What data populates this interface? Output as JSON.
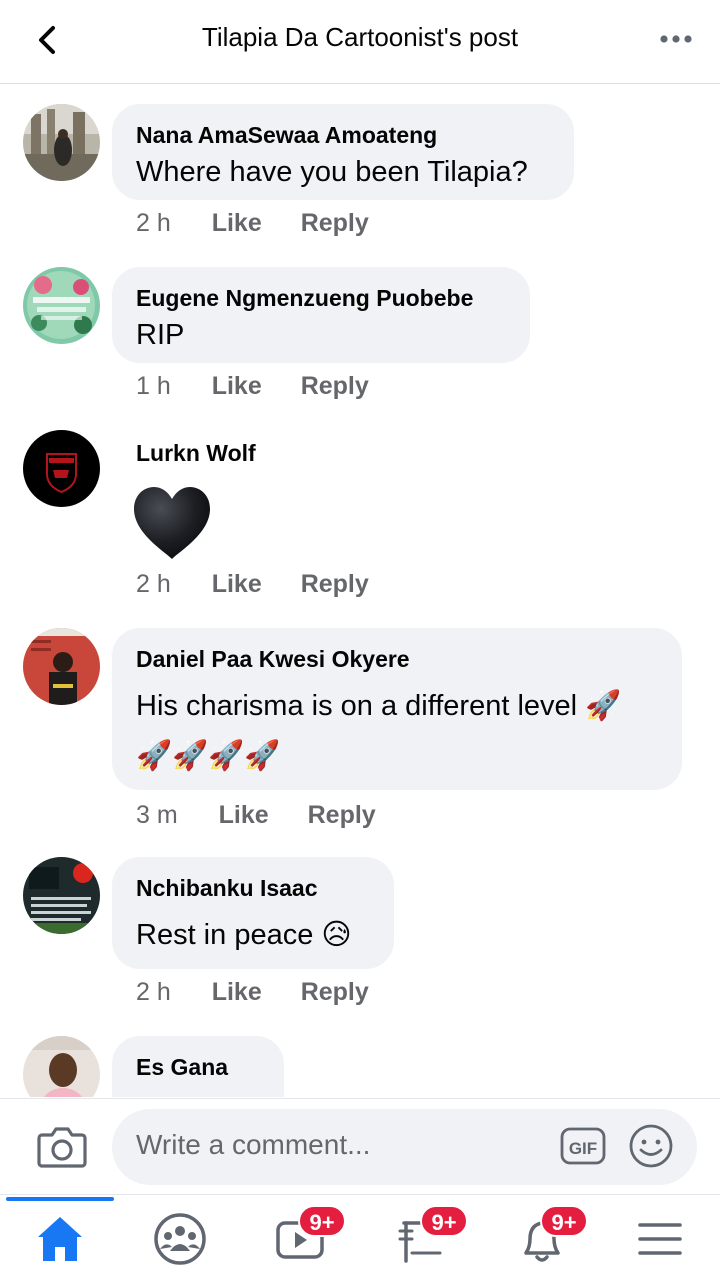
{
  "header": {
    "title": "Tilapia Da Cartoonist's post",
    "back_icon": "chevron-left-icon",
    "more_icon": "more-horizontal-icon"
  },
  "comments": [
    {
      "author": "Nana AmaSewaa Amoateng",
      "text": "Where have you been Tilapia?",
      "time": "2 h",
      "like": "Like",
      "reply": "Reply"
    },
    {
      "author": "Eugene Ngmenzueng Puobebe",
      "text": "RIP",
      "time": "1 h",
      "like": "Like",
      "reply": "Reply"
    },
    {
      "author": "Lurkn Wolf",
      "text": "",
      "time": "2 h",
      "like": "Like",
      "reply": "Reply",
      "sticker": "black-heart-emoji"
    },
    {
      "author": "Daniel Paa Kwesi Okyere",
      "text": "His charisma is on a different level 🚀",
      "text2": "🚀🚀🚀🚀",
      "time": "3 m",
      "like": "Like",
      "reply": "Reply"
    },
    {
      "author": "Nchibanku Isaac",
      "text": "Rest in peace 😥",
      "time": "2 h",
      "like": "Like",
      "reply": "Reply"
    },
    {
      "author": "Es Gana",
      "text": "",
      "time": "",
      "like": "",
      "reply": ""
    }
  ],
  "composer": {
    "placeholder": "Write a comment...",
    "gif_label": "GIF"
  },
  "nav": {
    "badges": {
      "watch": "9+",
      "marketplace": "9+",
      "notifications": "9+"
    },
    "accent": "#1877f2",
    "badge_color": "#e41e3f"
  }
}
